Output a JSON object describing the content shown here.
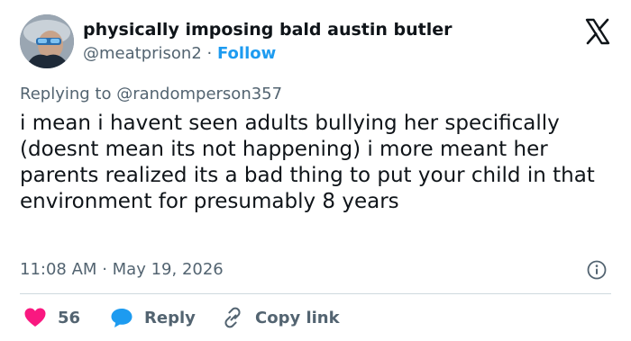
{
  "author": {
    "display_name": "physically imposing bald austin butler",
    "handle": "@meatprison2",
    "separator": "·",
    "follow_label": "Follow",
    "avatar_icon": "profile-photo"
  },
  "platform": {
    "logo_icon": "x-logo-icon"
  },
  "reply_context": {
    "prefix": "Replying to",
    "mention": "@randomperson357"
  },
  "tweet": {
    "text": "i mean i havent seen adults bullying her specifically (doesnt mean its not happening) i more meant her parents realized its a bad thing to put your child in that environment for presumably 8 years",
    "time": "11:08 AM",
    "separator": "·",
    "date": "May 19, 2026"
  },
  "actions": {
    "like_count": "56",
    "reply_label": "Reply",
    "copy_link_label": "Copy link"
  },
  "colors": {
    "like": "#f91880",
    "reply": "#1d9bf0",
    "link_accent": "#1d9bf0",
    "muted": "#536471",
    "text": "#0f1419",
    "divider": "#cfd9de"
  }
}
